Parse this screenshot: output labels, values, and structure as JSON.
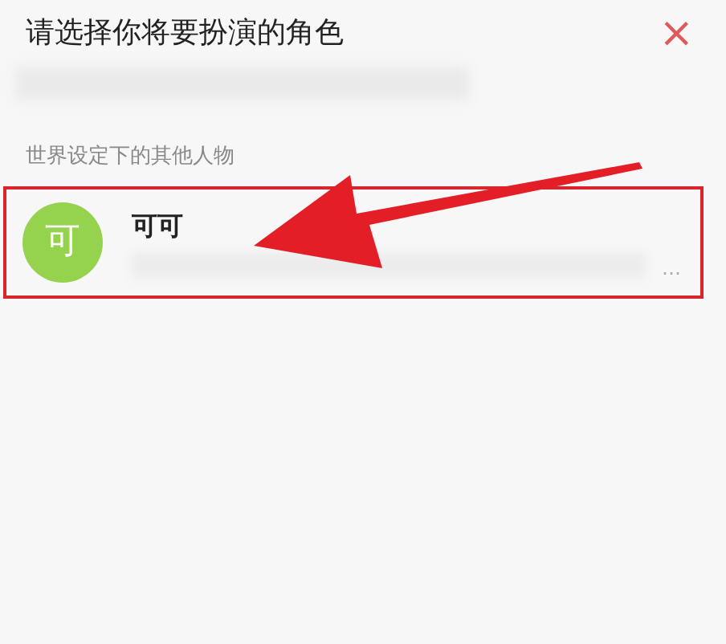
{
  "dialog": {
    "title": "请选择你将要扮演的角色",
    "close": "×"
  },
  "section": {
    "label": "世界设定下的其他人物",
    "characters": [
      {
        "avatar": "可",
        "name": "可可",
        "description_end": "…",
        "highlighted": true
      }
    ]
  }
}
